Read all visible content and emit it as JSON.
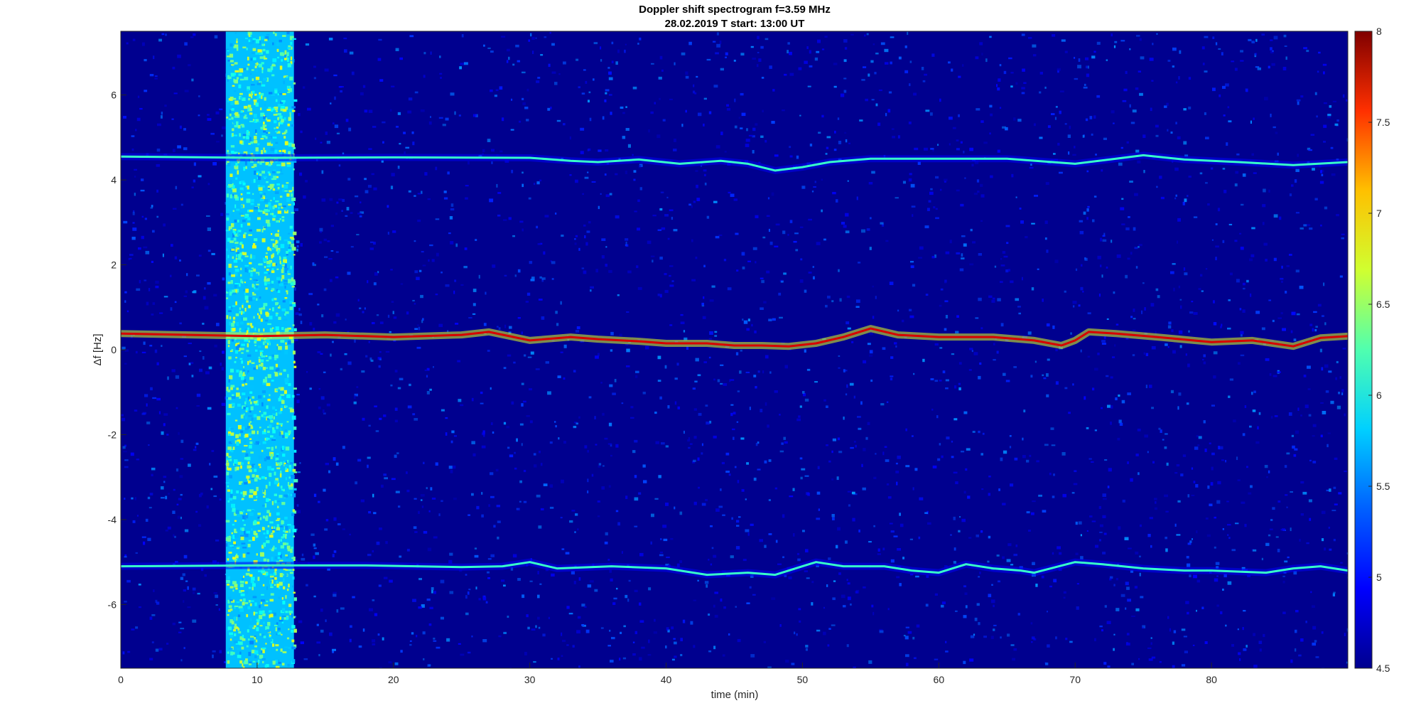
{
  "chart_data": {
    "type": "heatmap",
    "title": "Doppler shift spectrogram f=3.59 MHz",
    "subtitle": "28.02.2019   T start: 13:00 UT",
    "xlabel": "time (min)",
    "ylabel": "Δf [Hz]",
    "xlim": [
      0,
      90
    ],
    "ylim": [
      -7.5,
      7.5
    ],
    "x_ticks": [
      0,
      10,
      20,
      30,
      40,
      50,
      60,
      70,
      80
    ],
    "y_ticks": [
      -6,
      -4,
      -2,
      0,
      2,
      4,
      6
    ],
    "colorbar": {
      "range": [
        4.5,
        8
      ],
      "ticks": [
        4.5,
        5,
        5.5,
        6,
        6.5,
        7,
        7.5,
        8
      ],
      "colormap": [
        "#00008f",
        "#0000ff",
        "#0080ff",
        "#00ffff",
        "#80ff80",
        "#ffff00",
        "#ff8000",
        "#ff0000",
        "#800000"
      ]
    },
    "background_level": 4.9,
    "interference_band": {
      "time_range": [
        7.7,
        12.7
      ],
      "level": 6.3
    },
    "traces": [
      {
        "label": "upper",
        "level": 6.0,
        "points": [
          [
            0,
            4.55
          ],
          [
            10,
            4.52
          ],
          [
            20,
            4.53
          ],
          [
            30,
            4.52
          ],
          [
            33,
            4.45
          ],
          [
            35,
            4.42
          ],
          [
            38,
            4.48
          ],
          [
            41,
            4.38
          ],
          [
            44,
            4.45
          ],
          [
            46,
            4.38
          ],
          [
            48,
            4.22
          ],
          [
            50,
            4.3
          ],
          [
            52,
            4.42
          ],
          [
            55,
            4.5
          ],
          [
            60,
            4.5
          ],
          [
            65,
            4.5
          ],
          [
            70,
            4.38
          ],
          [
            73,
            4.5
          ],
          [
            75,
            4.58
          ],
          [
            78,
            4.48
          ],
          [
            82,
            4.42
          ],
          [
            86,
            4.35
          ],
          [
            90,
            4.42
          ]
        ]
      },
      {
        "label": "middle",
        "level": 7.7,
        "points": [
          [
            0,
            0.38
          ],
          [
            10,
            0.32
          ],
          [
            15,
            0.35
          ],
          [
            20,
            0.3
          ],
          [
            25,
            0.35
          ],
          [
            27,
            0.42
          ],
          [
            30,
            0.22
          ],
          [
            33,
            0.3
          ],
          [
            35,
            0.25
          ],
          [
            38,
            0.2
          ],
          [
            40,
            0.15
          ],
          [
            43,
            0.15
          ],
          [
            45,
            0.1
          ],
          [
            47,
            0.1
          ],
          [
            49,
            0.08
          ],
          [
            51,
            0.15
          ],
          [
            53,
            0.3
          ],
          [
            55,
            0.5
          ],
          [
            57,
            0.35
          ],
          [
            60,
            0.3
          ],
          [
            64,
            0.3
          ],
          [
            67,
            0.22
          ],
          [
            69,
            0.1
          ],
          [
            70,
            0.22
          ],
          [
            71,
            0.42
          ],
          [
            73,
            0.38
          ],
          [
            76,
            0.3
          ],
          [
            80,
            0.18
          ],
          [
            83,
            0.22
          ],
          [
            86,
            0.08
          ],
          [
            88,
            0.28
          ],
          [
            90,
            0.32
          ]
        ]
      },
      {
        "label": "lower",
        "level": 6.0,
        "points": [
          [
            0,
            -5.1
          ],
          [
            10,
            -5.08
          ],
          [
            18,
            -5.08
          ],
          [
            25,
            -5.12
          ],
          [
            28,
            -5.1
          ],
          [
            30,
            -5.0
          ],
          [
            32,
            -5.15
          ],
          [
            36,
            -5.1
          ],
          [
            40,
            -5.15
          ],
          [
            43,
            -5.3
          ],
          [
            46,
            -5.25
          ],
          [
            48,
            -5.3
          ],
          [
            50,
            -5.1
          ],
          [
            51,
            -5.0
          ],
          [
            53,
            -5.1
          ],
          [
            56,
            -5.1
          ],
          [
            58,
            -5.2
          ],
          [
            60,
            -5.25
          ],
          [
            62,
            -5.05
          ],
          [
            64,
            -5.15
          ],
          [
            66,
            -5.2
          ],
          [
            67,
            -5.25
          ],
          [
            70,
            -5.0
          ],
          [
            72,
            -5.05
          ],
          [
            75,
            -5.15
          ],
          [
            78,
            -5.2
          ],
          [
            80,
            -5.2
          ],
          [
            84,
            -5.25
          ],
          [
            86,
            -5.15
          ],
          [
            88,
            -5.1
          ],
          [
            90,
            -5.2
          ]
        ]
      }
    ]
  }
}
